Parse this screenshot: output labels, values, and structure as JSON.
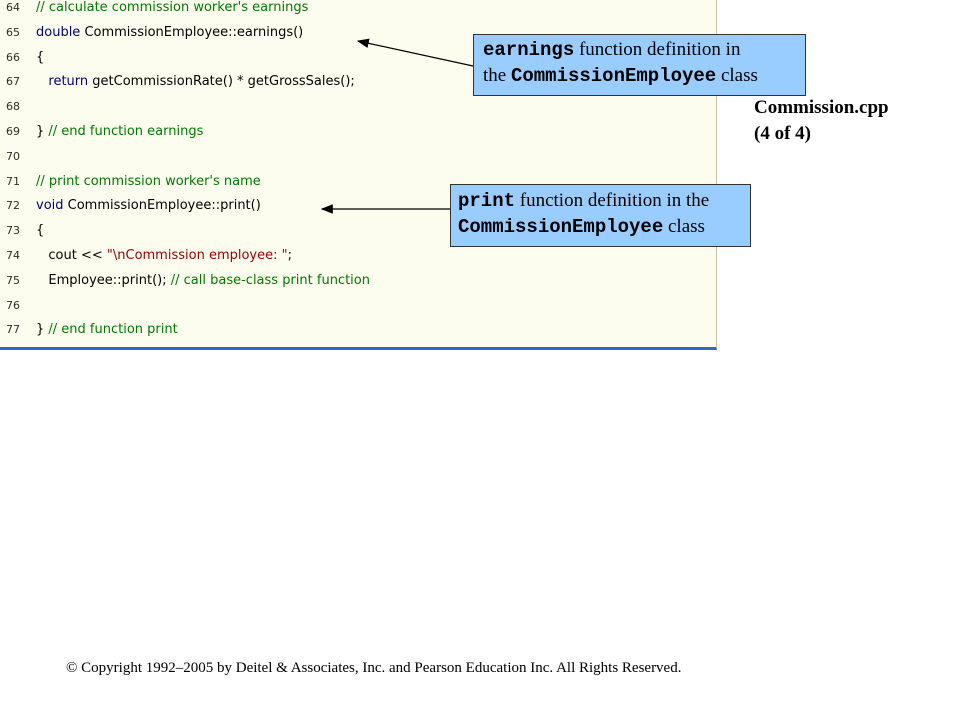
{
  "code_lines": [
    {
      "num": "64",
      "parts": [
        {
          "t": "// calculate commission worker's earnings",
          "c": "cm"
        }
      ]
    },
    {
      "num": "65",
      "parts": [
        {
          "t": "double",
          "c": "kw"
        },
        {
          "t": " CommissionEmployee::earnings()",
          "c": ""
        }
      ]
    },
    {
      "num": "66",
      "parts": [
        {
          "t": "{",
          "c": ""
        }
      ]
    },
    {
      "num": "67",
      "parts": [
        {
          "t": "   ",
          "c": ""
        },
        {
          "t": "return",
          "c": "kw"
        },
        {
          "t": " getCommissionRate() * getGrossSales();",
          "c": ""
        }
      ]
    },
    {
      "num": "68",
      "parts": []
    },
    {
      "num": "69",
      "parts": [
        {
          "t": "} ",
          "c": ""
        },
        {
          "t": "// end function earnings",
          "c": "cm"
        }
      ]
    },
    {
      "num": "70",
      "parts": []
    },
    {
      "num": "71",
      "parts": [
        {
          "t": "// print commission worker's name",
          "c": "cm"
        }
      ]
    },
    {
      "num": "72",
      "parts": [
        {
          "t": "void",
          "c": "kw"
        },
        {
          "t": " CommissionEmployee::print()",
          "c": ""
        }
      ]
    },
    {
      "num": "73",
      "parts": [
        {
          "t": "{",
          "c": ""
        }
      ]
    },
    {
      "num": "74",
      "parts": [
        {
          "t": "   cout << ",
          "c": ""
        },
        {
          "t": "\"\\nCommission employee: \"",
          "c": "st"
        },
        {
          "t": ";",
          "c": ""
        }
      ]
    },
    {
      "num": "75",
      "parts": [
        {
          "t": "   Employee::print(); ",
          "c": ""
        },
        {
          "t": "// call base-class print function",
          "c": "cm"
        }
      ]
    },
    {
      "num": "76",
      "parts": []
    },
    {
      "num": "77",
      "parts": [
        {
          "t": "} ",
          "c": ""
        },
        {
          "t": "// end function print",
          "c": "cm"
        }
      ]
    }
  ],
  "callouts": {
    "earnings": {
      "mono1": "earnings",
      "text1": " function definition in",
      "text2": "the ",
      "mono2": "CommissionEmployee",
      "text3": " class"
    },
    "print": {
      "mono1": "print",
      "text1": " function definition in the",
      "mono2": "CommissionEmployee",
      "text3": " class"
    }
  },
  "side_label": {
    "line1": "Commission.cpp",
    "line2": "(4 of 4)"
  },
  "copyright": "© Copyright 1992–2005 by Deitel & Associates, Inc. and Pearson Education Inc. All Rights Reserved."
}
